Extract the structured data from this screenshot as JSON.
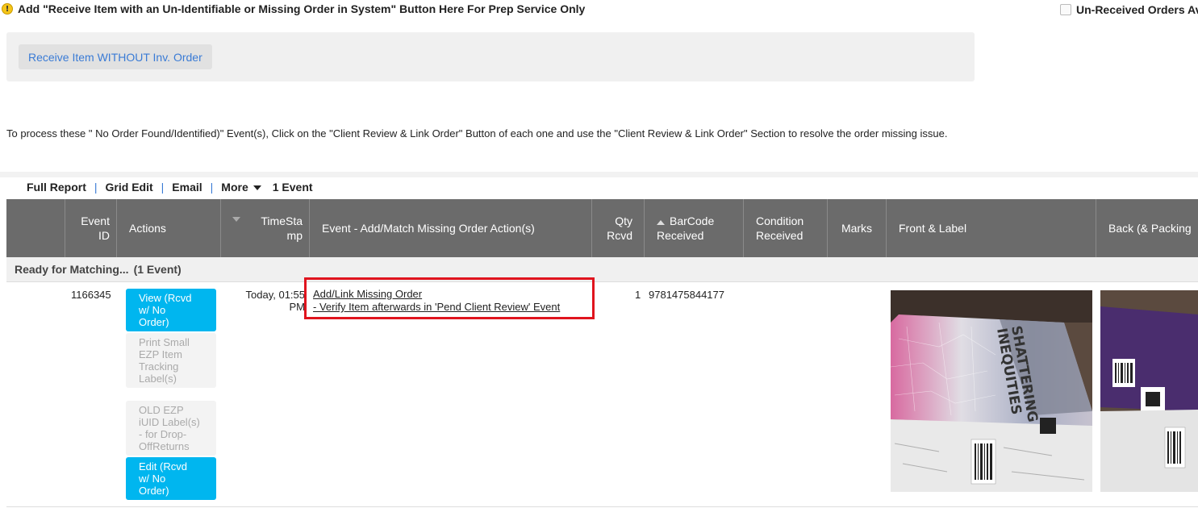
{
  "notice": {
    "icon": "info-icon",
    "text": "Add \"Receive Item with an Un-Identifiable or Missing Order in System\" Button Here For Prep Service Only"
  },
  "unreceived_label": "Un-Received Orders Ava",
  "receive_button": "Receive Item WITHOUT Inv. Order",
  "instructions": "To process these \" No Order Found/Identified)\" Event(s), Click on the \"Client Review & Link Order\" Button of each one and use the \"Client Review & Link Order\" Section to resolve the order missing issue.",
  "toolbar": {
    "full_report": "Full Report",
    "grid_edit": "Grid Edit",
    "email": "Email",
    "more": "More",
    "event_count": "1 Event"
  },
  "columns": {
    "event_id": [
      "Event",
      "ID"
    ],
    "actions": "Actions",
    "timestamp": [
      "TimeSta",
      "mp"
    ],
    "event_action": "Event - Add/Match Missing Order Action(s)",
    "qty": [
      "Qty",
      "Rcvd"
    ],
    "barcode": [
      "BarCode",
      "Received"
    ],
    "condition": [
      "Condition",
      "Received"
    ],
    "marks": "Marks",
    "front_label": "Front & Label",
    "back_packing": "Back (& Packing"
  },
  "group": {
    "label": "Ready for Matching...",
    "count": "(1 Event)"
  },
  "row": {
    "event_id": "1166345",
    "timestamp": [
      "Today, 01:55",
      "PM"
    ],
    "qty": "1",
    "barcode": "9781475844177",
    "actions": {
      "view": [
        "View (Rcvd",
        "w/ No",
        "Order)"
      ],
      "print": [
        "Print Small",
        "EZP Item",
        "Tracking",
        "Label(s)"
      ],
      "old_label": [
        "OLD EZP",
        "iUID Label(s)",
        "- for Drop-",
        "OffReturns"
      ],
      "edit": [
        "Edit (Rcvd",
        "w/ No",
        "Order)"
      ]
    },
    "event_links": {
      "add_link": "Add/Link Missing Order",
      "verify": "- Verify Item afterwards in 'Pend Client Review' Event"
    },
    "front_photo": {
      "book_title": [
        "SHATTERING",
        "INEQUITIES"
      ]
    }
  },
  "colors": {
    "header_bg": "#6b6b6b",
    "cyan_button": "#00b6ef",
    "link_blue": "#3a7bd5",
    "highlight_red": "#e0141e"
  }
}
